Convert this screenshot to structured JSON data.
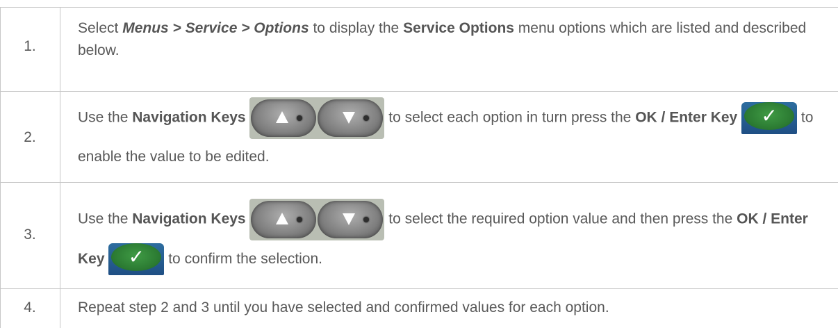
{
  "steps": [
    {
      "number": "1.",
      "parts": [
        "Select ",
        "Menus > Service > Options",
        " to display the ",
        "Service Options",
        " menu options which are listed and described below."
      ]
    },
    {
      "number": "2.",
      "parts": [
        "Use the ",
        "Navigation Keys",
        " to select each option in turn press the ",
        "OK / Enter Key",
        " to enable the value to be edited."
      ]
    },
    {
      "number": "3.",
      "parts": [
        "Use the ",
        "Navigation Keys",
        " to select the required option value and then press the ",
        "OK / Enter Key",
        " to confirm the selection."
      ]
    },
    {
      "number": "4.",
      "parts": [
        "Repeat step 2 and 3 until you have selected and confirmed values for each option."
      ]
    }
  ],
  "icons": {
    "nav_up": "navigation-up-key-icon",
    "nav_down": "navigation-down-key-icon",
    "ok": "ok-enter-key-icon",
    "check_glyph": "✓"
  },
  "colors": {
    "text": "#595959",
    "rule": "#c6c6c6",
    "ok_green": "#2b7a32",
    "ok_blue": "#1f4f84",
    "nav_gray": "#7f7f7f"
  }
}
